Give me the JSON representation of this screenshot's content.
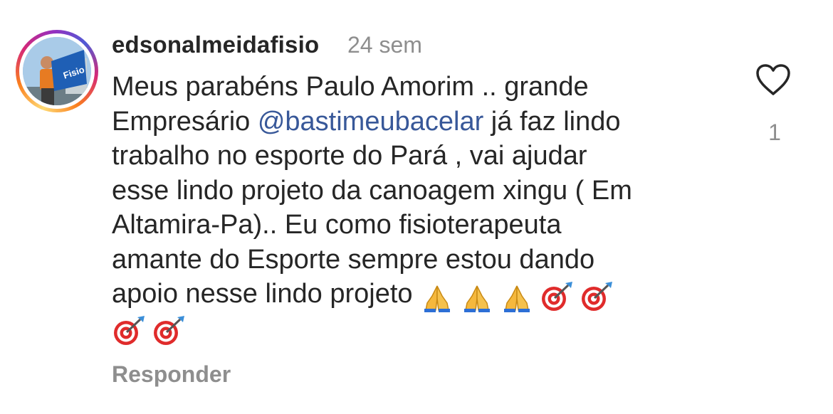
{
  "comment": {
    "username": "edsonalmeidafisio",
    "time": "24 sem",
    "text_lines": [
      {
        "before": "Meus parabéns Paulo Amorim .. grande",
        "mention": "",
        "after": ""
      },
      {
        "before": "Empresário ",
        "mention": "@bastimeubacelar",
        "after": "  já faz lindo"
      },
      {
        "before": "trabalho no esporte do Pará , vai ajudar",
        "mention": "",
        "after": ""
      },
      {
        "before": "esse lindo projeto da canoagem xingu ( Em",
        "mention": "",
        "after": ""
      },
      {
        "before": "Altamira-Pa).. Eu como fisioterapeuta",
        "mention": "",
        "after": ""
      },
      {
        "before": "amante do Esporte sempre estou dando",
        "mention": "",
        "after": ""
      },
      {
        "before": "apoio nesse lindo projeto ",
        "mention": "",
        "after": ""
      }
    ],
    "emoji_line_1": [
      "folded-hands",
      "folded-hands",
      "folded-hands",
      "direct-hit",
      "direct-hit"
    ],
    "emoji_line_2": [
      "direct-hit",
      "direct-hit"
    ],
    "reply_label": "Responder",
    "like_count": "1",
    "avatar_banner_text": "Fisio",
    "colors": {
      "username": "#262626",
      "secondary": "#8e8e8e",
      "mention": "#385899"
    },
    "icons": {
      "like": "heart-outline-icon",
      "avatar": "profile-avatar"
    }
  }
}
